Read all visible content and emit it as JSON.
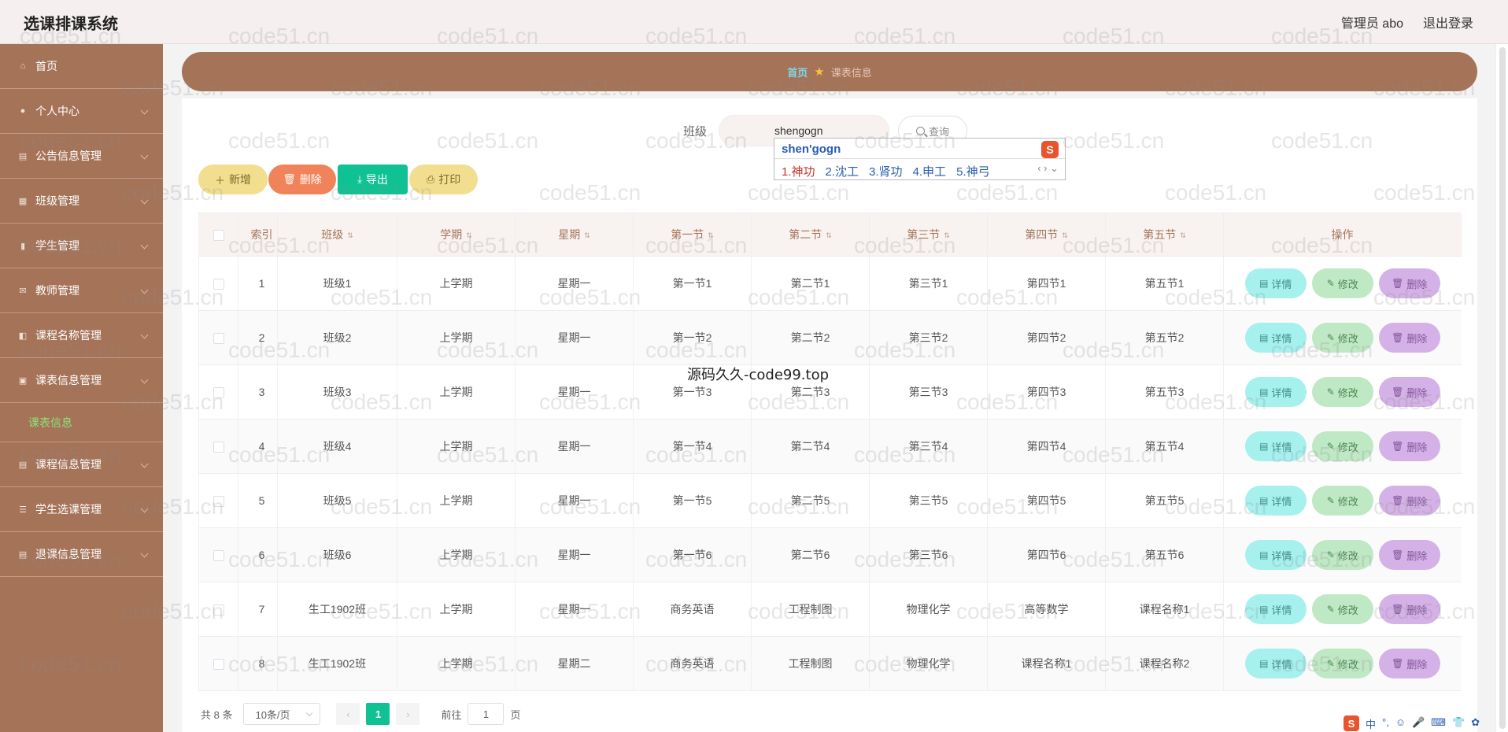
{
  "app": {
    "title": "选课排课系统",
    "user": "管理员 abo",
    "logout": "退出登录"
  },
  "sidebar": {
    "items": [
      {
        "label": "首页",
        "icon": "home-icon",
        "submenu": false
      },
      {
        "label": "个人中心",
        "icon": "user-icon",
        "submenu": true
      },
      {
        "label": "公告信息管理",
        "icon": "notice-icon",
        "submenu": true
      },
      {
        "label": "班级管理",
        "icon": "class-icon",
        "submenu": true
      },
      {
        "label": "学生管理",
        "icon": "chart-icon",
        "submenu": true
      },
      {
        "label": "教师管理",
        "icon": "mail-icon",
        "submenu": true
      },
      {
        "label": "课程名称管理",
        "icon": "tag-icon",
        "submenu": true
      },
      {
        "label": "课表信息管理",
        "icon": "suitcase-icon",
        "submenu": true
      }
    ],
    "active_sub": "课表信息",
    "items_after": [
      {
        "label": "课程信息管理",
        "icon": "document-icon",
        "submenu": true
      },
      {
        "label": "学生选课管理",
        "icon": "list-icon",
        "submenu": true
      },
      {
        "label": "退课信息管理",
        "icon": "document-icon",
        "submenu": true
      }
    ]
  },
  "breadcrumb": {
    "home": "首页",
    "current": "课表信息"
  },
  "search": {
    "label": "班级",
    "value": "shengogn",
    "button": "查询"
  },
  "ime": {
    "composition": "shen'gogn",
    "candidates": [
      "1.神功",
      "2.沈工",
      "3.肾功",
      "4.申工",
      "5.神弓"
    ],
    "logo": "S"
  },
  "toolbar": {
    "add": "新增",
    "delete": "删除",
    "export": "导出",
    "print": "打印"
  },
  "table": {
    "headers": [
      "索引",
      "班级",
      "学期",
      "星期",
      "第一节",
      "第二节",
      "第三节",
      "第四节",
      "第五节",
      "操作"
    ],
    "rows": [
      [
        "1",
        "班级1",
        "上学期",
        "星期一",
        "第一节1",
        "第二节1",
        "第三节1",
        "第四节1",
        "第五节1"
      ],
      [
        "2",
        "班级2",
        "上学期",
        "星期一",
        "第一节2",
        "第二节2",
        "第三节2",
        "第四节2",
        "第五节2"
      ],
      [
        "3",
        "班级3",
        "上学期",
        "星期一",
        "第一节3",
        "第二节3",
        "第三节3",
        "第四节3",
        "第五节3"
      ],
      [
        "4",
        "班级4",
        "上学期",
        "星期一",
        "第一节4",
        "第二节4",
        "第三节4",
        "第四节4",
        "第五节4"
      ],
      [
        "5",
        "班级5",
        "上学期",
        "星期一",
        "第一节5",
        "第二节5",
        "第三节5",
        "第四节5",
        "第五节5"
      ],
      [
        "6",
        "班级6",
        "上学期",
        "星期一",
        "第一节6",
        "第二节6",
        "第三节6",
        "第四节6",
        "第五节6"
      ],
      [
        "7",
        "生工1902班",
        "上学期",
        "星期一",
        "商务英语",
        "工程制图",
        "物理化学",
        "高等数学",
        "课程名称1"
      ],
      [
        "8",
        "生工1902班",
        "上学期",
        "星期二",
        "商务英语",
        "工程制图",
        "物理化学",
        "课程名称1",
        "课程名称2"
      ]
    ],
    "actions": {
      "detail": "详情",
      "edit": "修改",
      "delete": "删除"
    }
  },
  "pagination": {
    "total": "共 8 条",
    "page_size": "10条/页",
    "current_page": "1",
    "goto_label": "前往",
    "goto_value": "1",
    "page_unit": "页"
  },
  "watermark": {
    "text": "code51.cn",
    "center": "源码久久-code99.top"
  },
  "tray": {
    "items": [
      "中",
      "°,",
      "☺",
      "🎤",
      "⌨",
      "👕",
      "✿"
    ]
  },
  "colors": {
    "sidebar": "#a57358",
    "accent_green": "#10c293",
    "add_button": "#f1df8f",
    "delete_button": "#f08359",
    "detail_button": "#a6f0ed",
    "edit_button": "#bfe8c4",
    "row_delete_button": "#d4b1e6"
  }
}
